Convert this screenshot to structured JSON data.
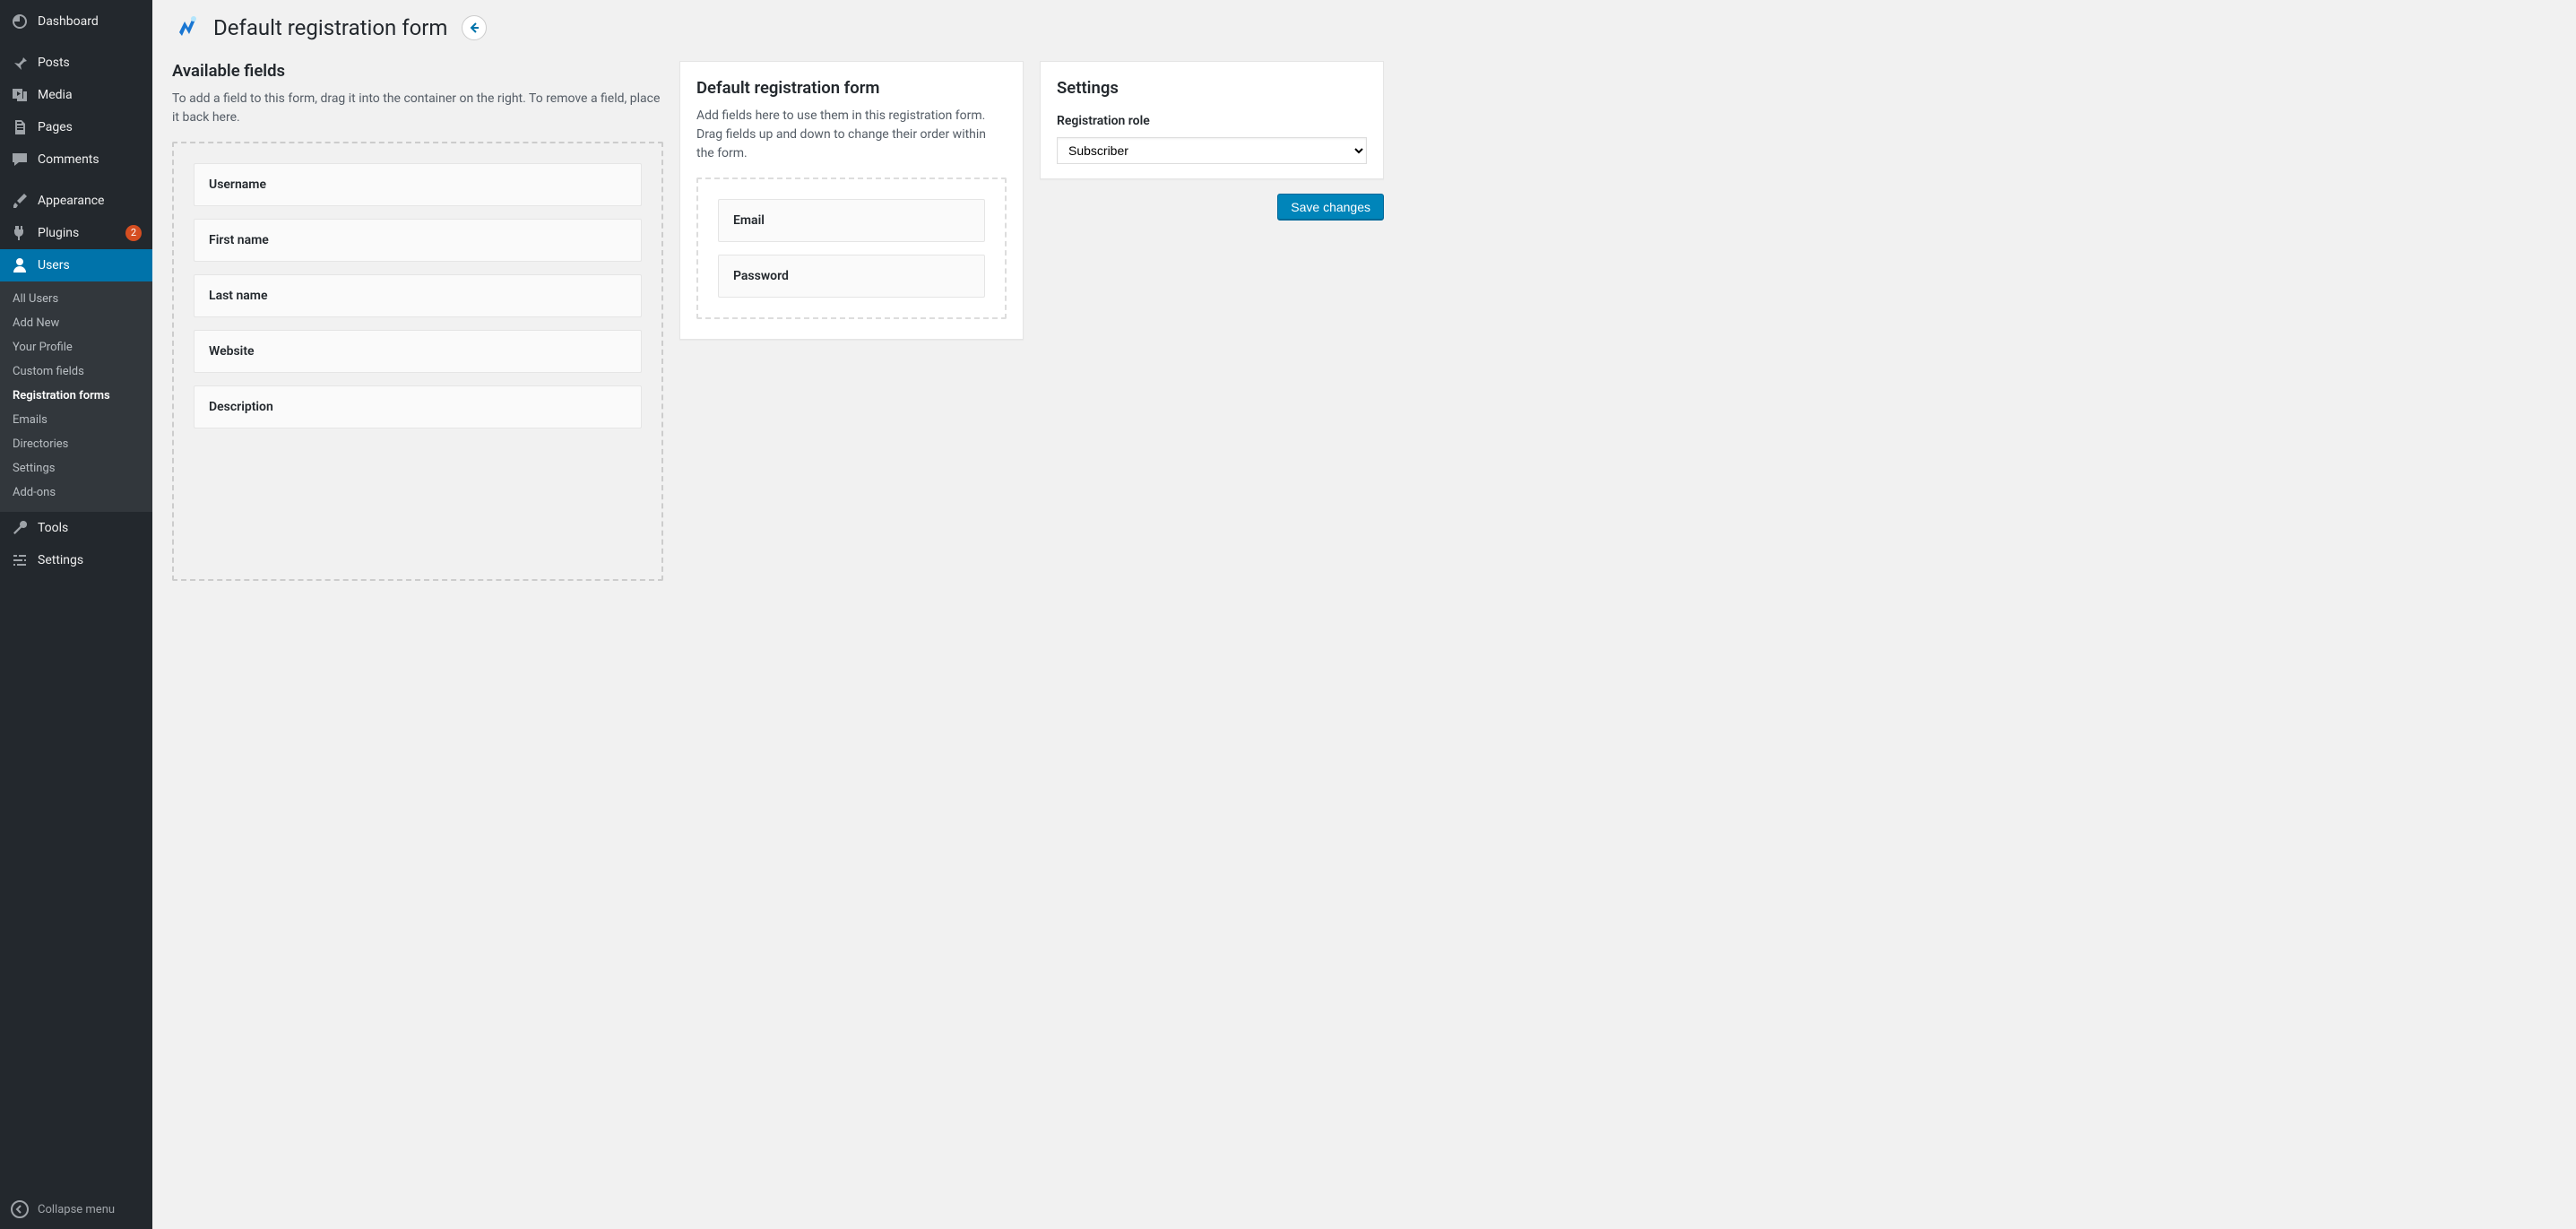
{
  "sidebar": {
    "items": [
      {
        "label": "Dashboard",
        "icon": "dashboard-icon"
      },
      {
        "sep": true
      },
      {
        "label": "Posts",
        "icon": "pin-icon"
      },
      {
        "label": "Media",
        "icon": "media-icon"
      },
      {
        "label": "Pages",
        "icon": "pages-icon"
      },
      {
        "label": "Comments",
        "icon": "comment-icon"
      },
      {
        "sep": true
      },
      {
        "label": "Appearance",
        "icon": "brush-icon"
      },
      {
        "label": "Plugins",
        "icon": "plug-icon",
        "badge": "2"
      },
      {
        "label": "Users",
        "icon": "user-icon",
        "active": true
      },
      {
        "label": "Tools",
        "icon": "wrench-icon"
      },
      {
        "label": "Settings",
        "icon": "sliders-icon"
      }
    ],
    "submenu": [
      {
        "label": "All Users"
      },
      {
        "label": "Add New"
      },
      {
        "label": "Your Profile"
      },
      {
        "label": "Custom fields"
      },
      {
        "label": "Registration forms",
        "current": true
      },
      {
        "label": "Emails"
      },
      {
        "label": "Directories"
      },
      {
        "label": "Settings"
      },
      {
        "label": "Add-ons"
      }
    ],
    "collapse_label": "Collapse menu"
  },
  "page": {
    "title": "Default registration form"
  },
  "available": {
    "title": "Available fields",
    "desc": "To add a field to this form, drag it into the container on the right. To remove a field, place it back here.",
    "fields": [
      "Username",
      "First name",
      "Last name",
      "Website",
      "Description"
    ]
  },
  "form": {
    "title": "Default registration form",
    "desc": "Add fields here to use them in this registration form. Drag fields up and down to change their order within the form.",
    "fields": [
      "Email",
      "Password"
    ]
  },
  "settings": {
    "title": "Settings",
    "reg_role_label": "Registration role",
    "reg_role_value": "Subscriber",
    "save_label": "Save changes"
  }
}
